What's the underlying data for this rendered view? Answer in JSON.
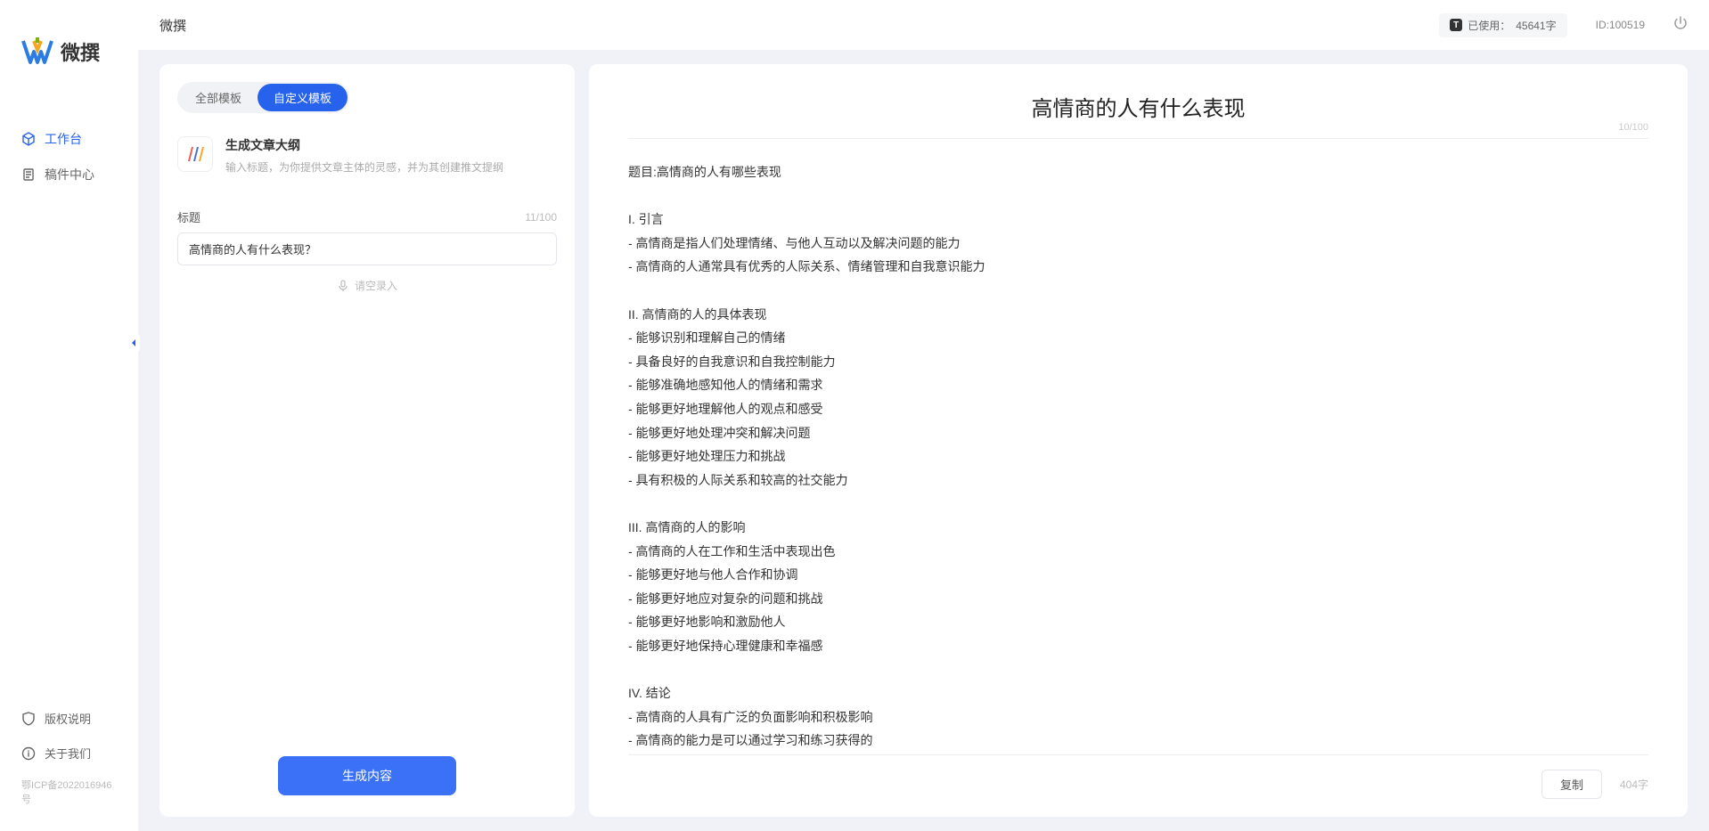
{
  "app": {
    "name": "微撰",
    "logo_text": "微撰"
  },
  "sidebar": {
    "items": [
      {
        "label": "工作台",
        "icon": "cube"
      },
      {
        "label": "稿件中心",
        "icon": "doc"
      }
    ],
    "bottom": [
      {
        "label": "版权说明",
        "icon": "shield"
      },
      {
        "label": "关于我们",
        "icon": "info"
      }
    ],
    "icp": "鄂ICP备2022016946号"
  },
  "topbar": {
    "title": "微撰",
    "usage_label": "已使用：",
    "usage_value": "45641字",
    "user_id_label": "ID:",
    "user_id_value": "100519"
  },
  "left_panel": {
    "tabs": [
      "全部模板",
      "自定义模板"
    ],
    "active_tab": 1,
    "template": {
      "title": "生成文章大纲",
      "desc": "输入标题，为你提供文章主体的灵感，并为其创建推文提纲"
    },
    "field": {
      "label": "标题",
      "count_label": "11/100",
      "value": "高情商的人有什么表现？"
    },
    "mic_label": "请空录入",
    "generate_btn": "生成内容"
  },
  "right_panel": {
    "title": "高情商的人有什么表现",
    "title_count": "10/100",
    "body": "题目:高情商的人有哪些表现\n\nI. 引言\n- 高情商是指人们处理情绪、与他人互动以及解决问题的能力\n- 高情商的人通常具有优秀的人际关系、情绪管理和自我意识能力\n\nII. 高情商的人的具体表现\n- 能够识别和理解自己的情绪\n- 具备良好的自我意识和自我控制能力\n- 能够准确地感知他人的情绪和需求\n- 能够更好地理解他人的观点和感受\n- 能够更好地处理冲突和解决问题\n- 能够更好地处理压力和挑战\n- 具有积极的人际关系和较高的社交能力\n\nIII. 高情商的人的影响\n- 高情商的人在工作和生活中表现出色\n- 能够更好地与他人合作和协调\n- 能够更好地应对复杂的问题和挑战\n- 能够更好地影响和激励他人\n- 能够更好地保持心理健康和幸福感\n\nIV. 结论\n- 高情商的人具有广泛的负面影响和积极影响\n- 高情商的能力是可以通过学习和练习获得的\n- 培养和提高高情商的能力对于个人的职业发展和生活质量至关重要。",
    "copy_btn": "复制",
    "word_count": "404字"
  }
}
